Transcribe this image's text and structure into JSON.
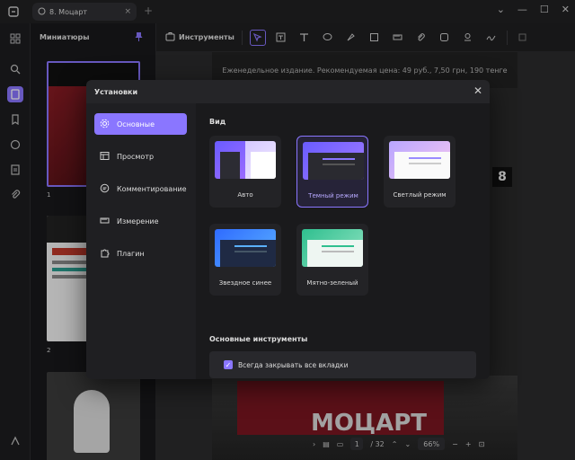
{
  "tab": {
    "title": "8. Моцарт"
  },
  "thumbnails": {
    "header": "Миниатюры",
    "page1": "1",
    "page2": "2"
  },
  "toolbar": {
    "tools_label": "Инструменты"
  },
  "document": {
    "top_text": "Еженедельное издание. Рекомендуемая цена: 49 руб., 7,50 грн, 190 тенге",
    "big_title": "МОЦАРТ",
    "issue_number": "8"
  },
  "status": {
    "current_page": "1",
    "total_pages": "/ 32",
    "zoom": "66%"
  },
  "dialog": {
    "title": "Установки",
    "nav": [
      {
        "label": "Основные"
      },
      {
        "label": "Просмотр"
      },
      {
        "label": "Комментирование"
      },
      {
        "label": "Измерение"
      },
      {
        "label": "Плагин"
      }
    ],
    "view_section": "Вид",
    "themes": [
      {
        "label": "Авто"
      },
      {
        "label": "Темный режим"
      },
      {
        "label": "Светлый режим"
      },
      {
        "label": "Звездное синее"
      },
      {
        "label": "Мятно-зеленый"
      }
    ],
    "tools_section": "Основные инструменты",
    "checkbox_label": "Всегда закрывать все вкладки"
  },
  "colors": {
    "accent": "#8a76ff",
    "background": "#1f1f21"
  }
}
